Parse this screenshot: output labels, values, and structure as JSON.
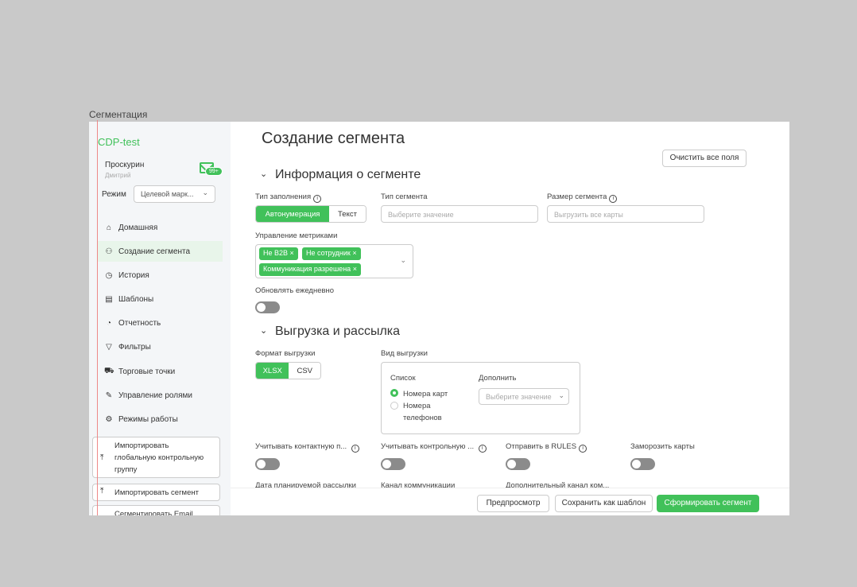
{
  "frame_label": "Сегментация",
  "sidebar": {
    "logo": "CDP-test",
    "user_name": "Проскурин",
    "user_sub": "Дмитрий",
    "badge": "99+",
    "mode_label": "Режим",
    "mode_value": "Целевой марк...",
    "items": [
      {
        "label": "Домашняя",
        "icon": "home-icon",
        "glyph": "⌂"
      },
      {
        "label": "Создание сегмента",
        "icon": "users-icon",
        "glyph": "⚇"
      },
      {
        "label": "История",
        "icon": "history-icon",
        "glyph": "◷"
      },
      {
        "label": "Шаблоны",
        "icon": "template-icon",
        "glyph": "▤"
      },
      {
        "label": "Отчетность",
        "icon": "pie-chart-icon",
        "glyph": "◔"
      },
      {
        "label": "Фильтры",
        "icon": "filter-icon",
        "glyph": "▽"
      },
      {
        "label": "Торговые точки",
        "icon": "cart-icon",
        "glyph": "⛟"
      },
      {
        "label": "Управление ролями",
        "icon": "pen-icon",
        "glyph": "✎"
      },
      {
        "label": "Режимы работы",
        "icon": "gear-icon",
        "glyph": "⚙"
      }
    ],
    "import_global": [
      "Импортировать",
      "глобальную контрольную",
      "группу"
    ],
    "import_segment": "Импортировать сегмент",
    "segment_email": "Сегментировать Email"
  },
  "main": {
    "title": "Создание сегмента",
    "clear_button": "Очистить все поля",
    "section_info": "Информация о сегменте",
    "fill_type_label": "Тип заполнения",
    "fill_type_options": [
      "Автонумерация",
      "Текст"
    ],
    "segment_type_label": "Тип сегмента",
    "segment_type_placeholder": "Выберите значение",
    "segment_size_label": "Размер сегмента",
    "segment_size_placeholder": "Выгрузить все карты",
    "metrics_label": "Управление метриками",
    "metrics_tags": [
      "Не B2B",
      "Не сотрудник",
      "Коммуникация разрешена"
    ],
    "daily_update_label": "Обновлять ежедневно",
    "section_export": "Выгрузка и рассылка",
    "format_label": "Формат выгрузки",
    "format_options": [
      "XLSX",
      "CSV"
    ],
    "export_type_label": "Вид выгрузки",
    "list_label": "Список",
    "radio_cards": "Номера карт",
    "radio_phones_1": "Номера",
    "radio_phones_2": "телефонов",
    "supplement_label": "Дополнить",
    "supplement_placeholder": "Выберите значение",
    "contact_label": "Учитывать контактную п...",
    "control_label": "Учитывать контрольную ...",
    "rules_label": "Отправить в RULES",
    "freeze_label": "Заморозить карты",
    "date_label": "Дата планируемой рассылки",
    "channel_label": "Канал коммуникации",
    "extra_channel_label": "Дополнительный канал ком...",
    "preview_button": "Предпросмотр",
    "save_template_button": "Сохранить как шаблон",
    "form_segment_button": "Сформировать сегмент"
  },
  "colors": {
    "accent": "#41c15a"
  }
}
